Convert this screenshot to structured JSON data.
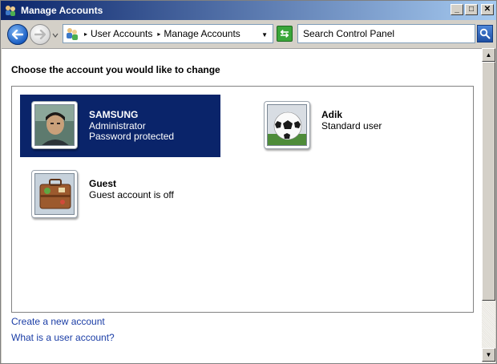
{
  "window": {
    "title": "Manage Accounts",
    "controls": {
      "minimize": "_",
      "maximize": "□",
      "close": "✕"
    }
  },
  "address": {
    "breadcrumb": [
      "User Accounts",
      "Manage Accounts"
    ],
    "separator": "▸",
    "search_placeholder": "Search Control Panel"
  },
  "content": {
    "heading": "Choose the account you would like to change",
    "accounts": [
      {
        "name": "SAMSUNG",
        "lines": [
          "Administrator",
          "Password protected"
        ],
        "selected": true,
        "picture": "person-photo"
      },
      {
        "name": "Adik",
        "lines": [
          "Standard user"
        ],
        "selected": false,
        "picture": "soccer-ball"
      },
      {
        "name": "Guest",
        "lines": [
          "Guest account is off"
        ],
        "selected": false,
        "picture": "suitcase"
      }
    ],
    "links": {
      "create": "Create a new account",
      "what_is": "What is a user account?"
    }
  },
  "colors": {
    "selection": "#0a246a",
    "link": "#1a3da6",
    "title_gradient_start": "#0a246a",
    "title_gradient_end": "#a6caf0"
  }
}
